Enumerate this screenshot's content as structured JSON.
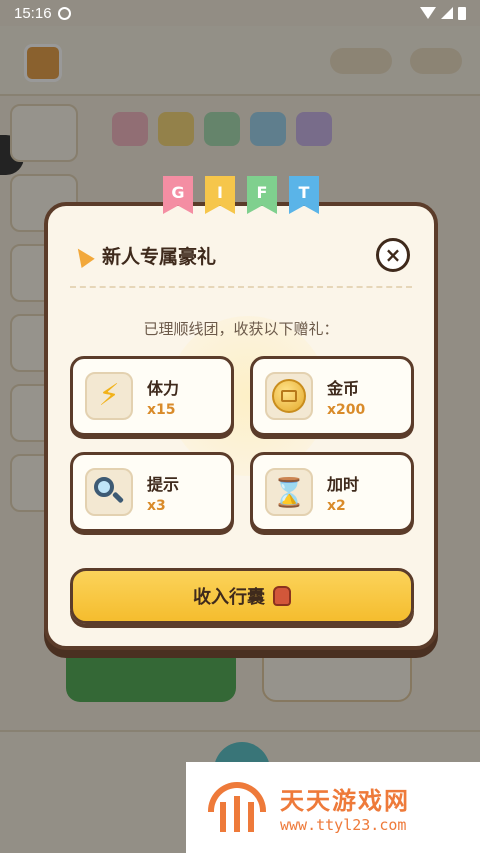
{
  "status_bar": {
    "time": "15:16"
  },
  "gift_flags": [
    "G",
    "I",
    "F",
    "T"
  ],
  "modal": {
    "title": "新人专属豪礼",
    "close_symbol": "×",
    "subtitle": "已理顺线团，收获以下赠礼：",
    "rewards": [
      {
        "name": "体力",
        "qty": "x15",
        "icon": "lightning-icon"
      },
      {
        "name": "金币",
        "qty": "x200",
        "icon": "coin-icon"
      },
      {
        "name": "提示",
        "qty": "x3",
        "icon": "magnifier-icon"
      },
      {
        "name": "加时",
        "qty": "x2",
        "icon": "hourglass-icon"
      }
    ],
    "collect_label": "收入行囊"
  },
  "watermark": {
    "title": "天天游戏网",
    "url": "www.ttyl23.com"
  },
  "colors": {
    "modal_border": "#5b3c2a",
    "collect_button": "#f5bd2e",
    "quantity_text": "#d98b2a",
    "watermark": "#ee7a3a"
  }
}
